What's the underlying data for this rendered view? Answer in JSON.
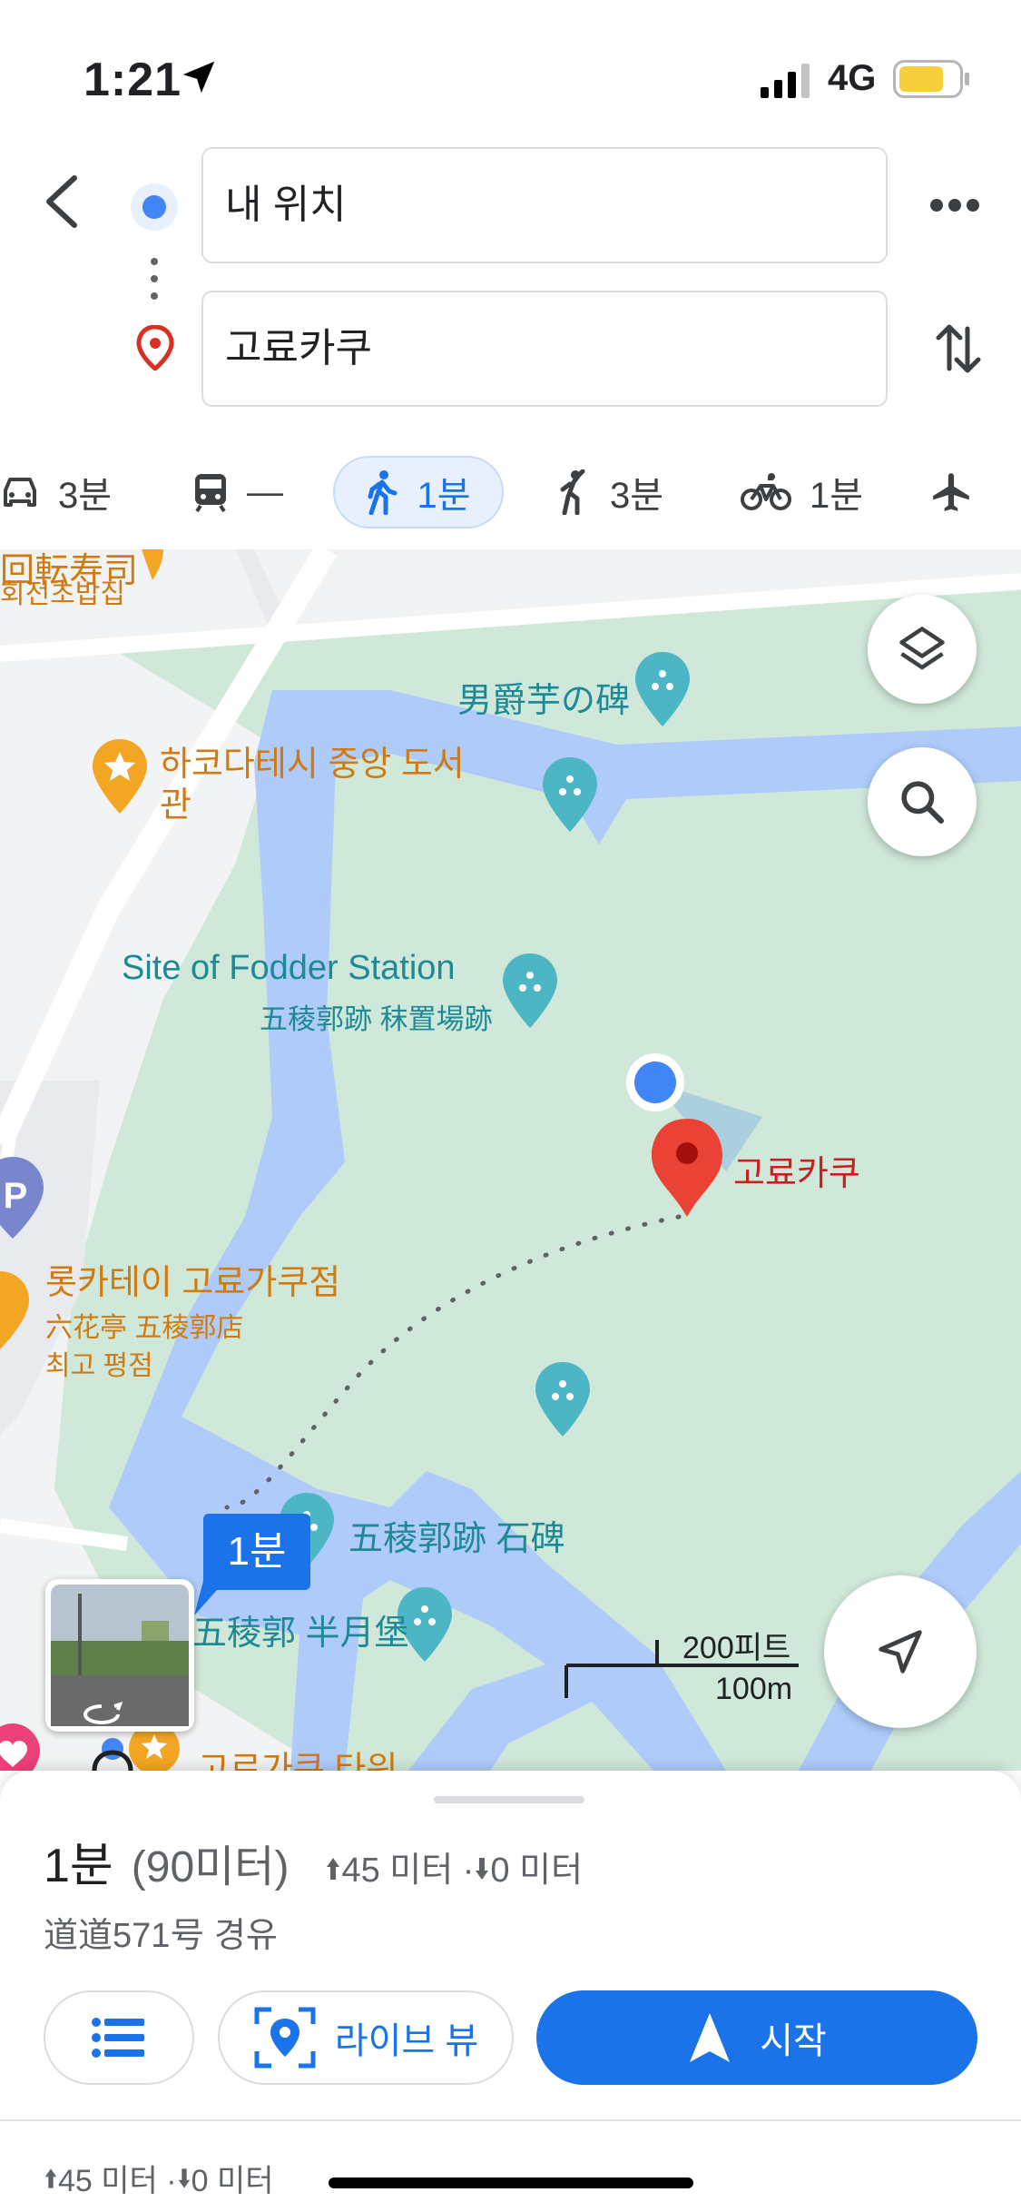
{
  "status_bar": {
    "time": "1:21",
    "network": "4G"
  },
  "header": {
    "origin": "내 위치",
    "destination": "고료카쿠"
  },
  "modes": [
    {
      "icon": "car-icon",
      "label": "3분"
    },
    {
      "icon": "transit-icon",
      "label": "—"
    },
    {
      "icon": "walk-icon",
      "label": "1분"
    },
    {
      "icon": "ride-hail-icon",
      "label": "3분"
    },
    {
      "icon": "bicycle-icon",
      "label": "1분"
    },
    {
      "icon": "flight-icon",
      "label": ""
    }
  ],
  "map": {
    "labels": {
      "top_left_1": "回転寿司",
      "top_left_2": "회전초밥집",
      "monument": "男爵芋の碑",
      "library_1": "하코다테시 중앙 도서",
      "library_2": "관",
      "fodder_en": "Site of Fodder Station",
      "fodder_jp": "五稜郭跡 秣置場跡",
      "destination": "고료카쿠",
      "restaurant_1": "롯카테이 고료가쿠점",
      "restaurant_2": "六花亭 五稜郭店",
      "restaurant_3": "최고 평점",
      "stone": "五稜郭跡 石碑",
      "hanget": "五稜郭 半月堡",
      "tower": "고료가쿠 타워",
      "parking": "P"
    },
    "route_badge": "1분",
    "scale_ft": "200피트",
    "scale_m": "100m"
  },
  "summary": {
    "duration": "1분",
    "distance": "(90미터)",
    "elevation": "45 미터 · ",
    "descent": "0 미터",
    "via": "道道571号 경유"
  },
  "actions": {
    "live_view": "라이브 뷰",
    "start": "시작"
  },
  "footer": {
    "elevation": "45 미터 · ",
    "descent": "0 미터"
  }
}
